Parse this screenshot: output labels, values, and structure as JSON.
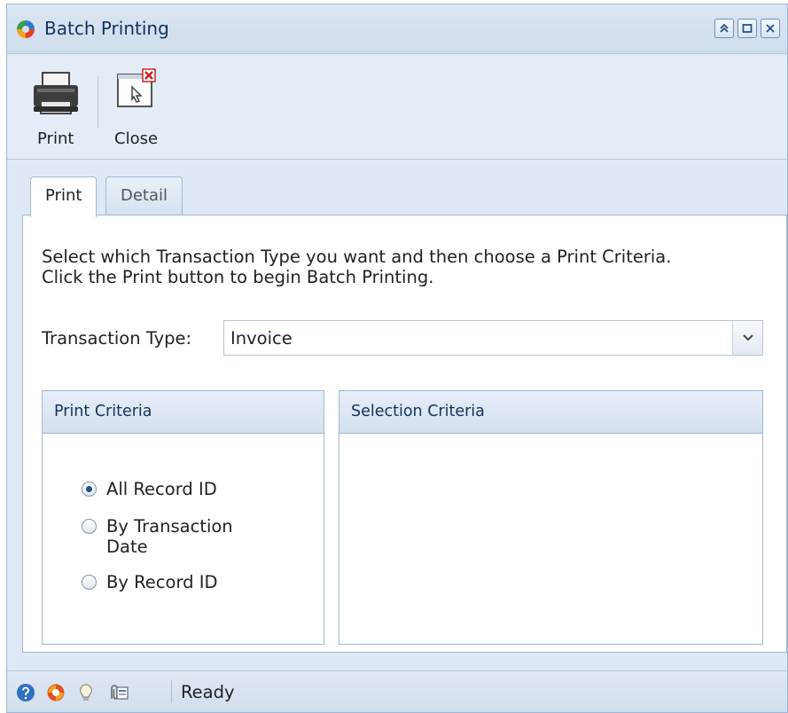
{
  "window": {
    "title": "Batch Printing",
    "title_buttons": [
      "collapse",
      "maximize",
      "close"
    ]
  },
  "toolbar": {
    "print_label": "Print",
    "close_label": "Close"
  },
  "tabs": [
    {
      "label": "Print",
      "active": true
    },
    {
      "label": "Detail",
      "active": false
    }
  ],
  "print_tab": {
    "instruction_line1": "Select which Transaction Type you want and then choose a Print Criteria.",
    "instruction_line2": "Click the Print button to begin Batch Printing.",
    "transaction_type_label": "Transaction Type:",
    "transaction_type_value": "Invoice",
    "print_criteria_header": "Print Criteria",
    "selection_criteria_header": "Selection Criteria",
    "radio_options": [
      {
        "line1": "All Record ID",
        "line2": "",
        "checked": true
      },
      {
        "line1": "By Transaction",
        "line2": "Date",
        "checked": false
      },
      {
        "line1": "By Record ID",
        "line2": "",
        "checked": false
      }
    ]
  },
  "statusbar": {
    "icons": [
      "help-icon",
      "lifebuoy-icon",
      "lightbulb-icon",
      "attachment-icon"
    ],
    "status_text": "Ready"
  },
  "colors": {
    "accent": "#1f4e8a",
    "window_bg": "#dfe9f5",
    "header_text": "#15325a"
  }
}
